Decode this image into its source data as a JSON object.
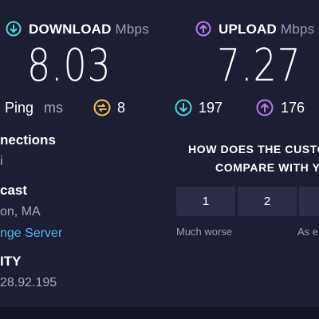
{
  "download": {
    "label": "DOWNLOAD",
    "unit": "Mbps",
    "value": "8.03",
    "color": "#4fd3dc"
  },
  "upload": {
    "label": "UPLOAD",
    "unit": "Mbps",
    "value": "7.27",
    "color": "#b77cf0"
  },
  "ping": {
    "label": "Ping",
    "unit": "ms",
    "jitter_value": "8",
    "download_value": "197",
    "upload_value": "176",
    "jitter_color": "#f2c94c"
  },
  "connections": {
    "title": "nections",
    "value": "i"
  },
  "server": {
    "title": "cast",
    "location": "on, MA",
    "change_link": "nge Server"
  },
  "provider": {
    "title": "ITY",
    "ip": "28.92.195"
  },
  "survey": {
    "question_line1": "HOW DOES THE CUSTO",
    "question_line2": "COMPARE WITH Y",
    "options": [
      "1",
      "2",
      ""
    ],
    "scale_low": "Much worse",
    "scale_mid": "As e"
  }
}
